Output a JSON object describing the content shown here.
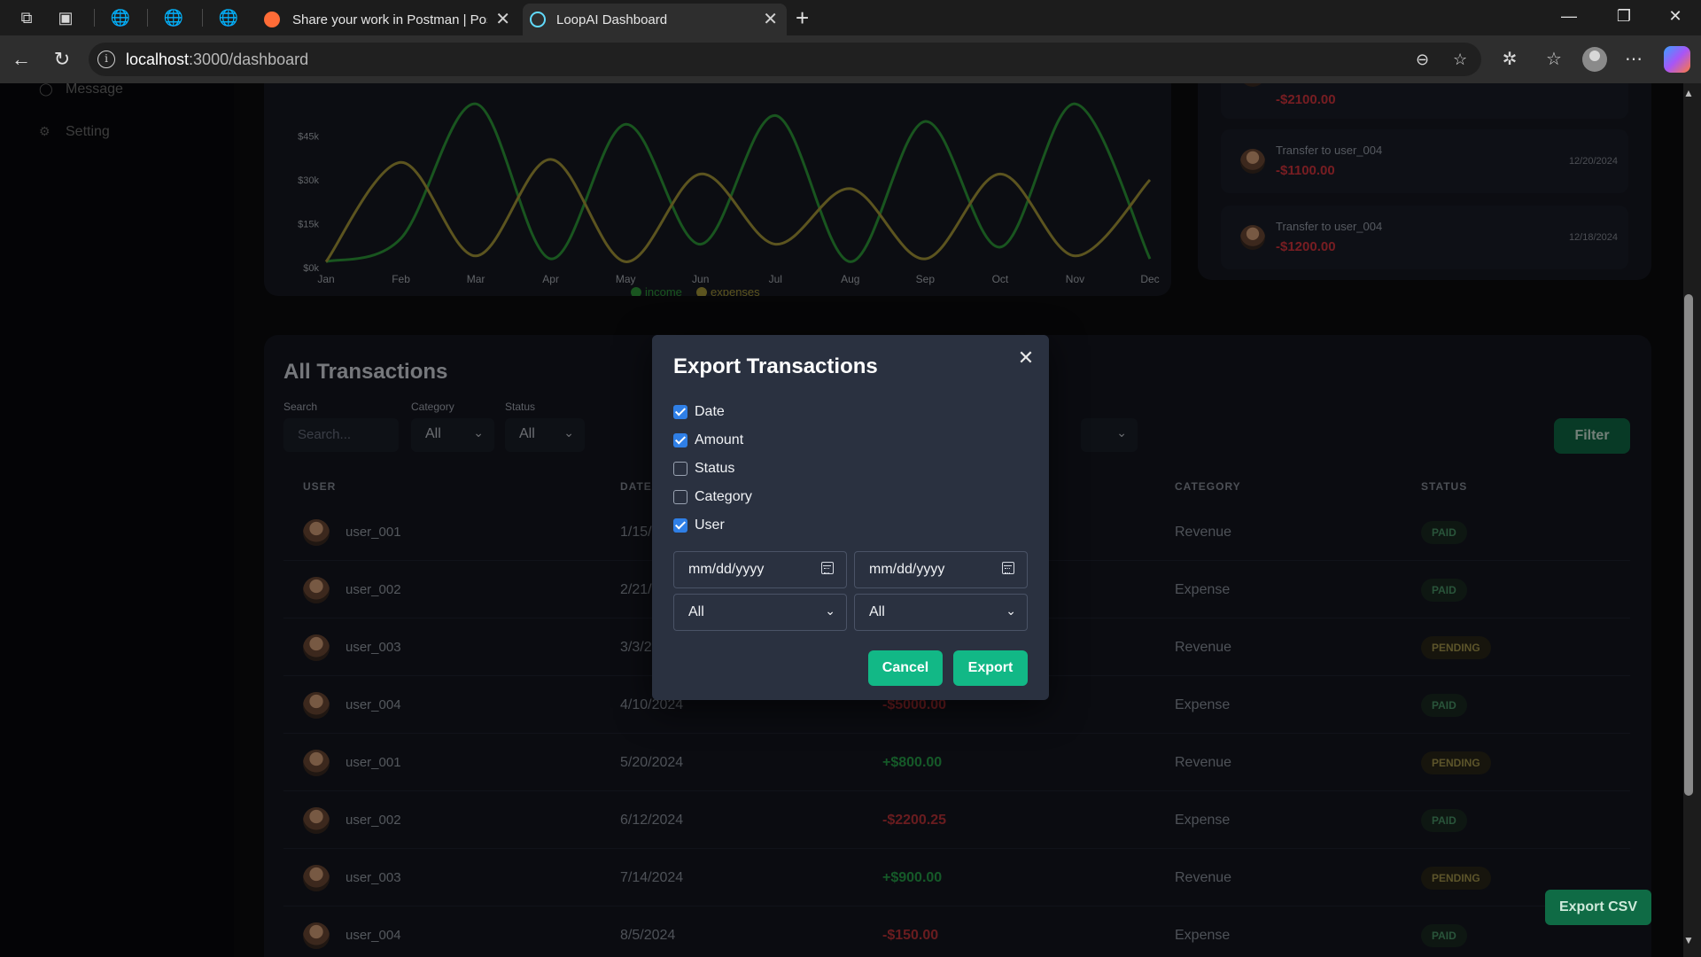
{
  "browser": {
    "tabs": [
      {
        "title": "Share your work in Postman | Post",
        "active": false
      },
      {
        "title": "LoopAI Dashboard",
        "active": true
      }
    ],
    "url_host": "localhost",
    "url_path": ":3000/dashboard"
  },
  "sidebar": {
    "items": [
      {
        "label": "Message",
        "icon": "message-icon"
      },
      {
        "label": "Setting",
        "icon": "gear-icon"
      }
    ]
  },
  "chart_data": {
    "type": "line",
    "categories": [
      "Jan",
      "Feb",
      "Mar",
      "Apr",
      "May",
      "Jun",
      "Jul",
      "Aug",
      "Sep",
      "Oct",
      "Nov",
      "Dec"
    ],
    "ytick_labels": [
      "$0k",
      "$15k",
      "$30k",
      "$45k"
    ],
    "ylim": [
      0,
      60000
    ],
    "series": [
      {
        "name": "income",
        "color": "#2e9b3a",
        "values": [
          2000,
          10000,
          56000,
          3000,
          49000,
          8000,
          52000,
          2000,
          50000,
          7000,
          56000,
          3000
        ]
      },
      {
        "name": "expenses",
        "color": "#a89a3a",
        "values": [
          2000,
          36000,
          4000,
          37000,
          2000,
          32000,
          8000,
          27000,
          3000,
          32000,
          4000,
          30000
        ]
      }
    ],
    "legend_position": "bottom"
  },
  "recent": {
    "items": [
      {
        "desc": "",
        "amount": "-$2100.00",
        "date": ""
      },
      {
        "desc": "Transfer to user_004",
        "amount": "-$1100.00",
        "date": "12/20/2024"
      },
      {
        "desc": "Transfer to user_004",
        "amount": "-$1200.00",
        "date": "12/18/2024"
      }
    ]
  },
  "transactions": {
    "title": "All Transactions",
    "filters": {
      "search_label": "Search",
      "search_placeholder": "Search...",
      "category_label": "Category",
      "category_value": "All",
      "status_label": "Status",
      "status_value": "All",
      "filter_button": "Filter"
    },
    "headers": {
      "user": "USER",
      "date": "DATE",
      "category": "CATEGORY",
      "status": "STATUS"
    },
    "rows": [
      {
        "user": "user_001",
        "date": "1/15/",
        "amount": "",
        "category": "Revenue",
        "status": "PAID"
      },
      {
        "user": "user_002",
        "date": "2/21/",
        "amount": "",
        "category": "Expense",
        "status": "PAID"
      },
      {
        "user": "user_003",
        "date": "3/3/2",
        "amount": "",
        "category": "Revenue",
        "status": "PENDING"
      },
      {
        "user": "user_004",
        "date": "4/10/2024",
        "amount": "-$5000.00",
        "category": "Expense",
        "status": "PAID"
      },
      {
        "user": "user_001",
        "date": "5/20/2024",
        "amount": "+$800.00",
        "category": "Revenue",
        "status": "PENDING"
      },
      {
        "user": "user_002",
        "date": "6/12/2024",
        "amount": "-$2200.25",
        "category": "Expense",
        "status": "PAID"
      },
      {
        "user": "user_003",
        "date": "7/14/2024",
        "amount": "+$900.00",
        "category": "Revenue",
        "status": "PENDING"
      },
      {
        "user": "user_004",
        "date": "8/5/2024",
        "amount": "-$150.00",
        "category": "Expense",
        "status": "PAID"
      }
    ],
    "export_csv": "Export CSV"
  },
  "modal": {
    "title": "Export Transactions",
    "fields": [
      {
        "label": "Date",
        "checked": true
      },
      {
        "label": "Amount",
        "checked": true
      },
      {
        "label": "Status",
        "checked": false
      },
      {
        "label": "Category",
        "checked": false
      },
      {
        "label": "User",
        "checked": true
      }
    ],
    "start_date_placeholder": "mm/dd/yyyy",
    "end_date_placeholder": "mm/dd/yyyy",
    "category_value": "All",
    "status_value": "All",
    "cancel_label": "Cancel",
    "export_label": "Export"
  }
}
